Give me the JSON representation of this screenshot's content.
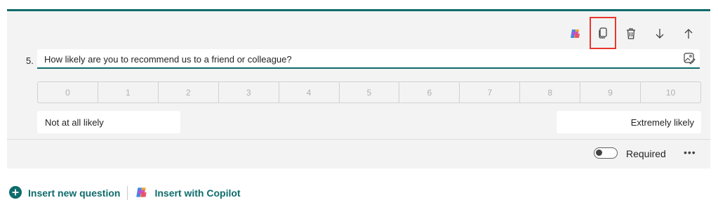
{
  "question": {
    "number": "5.",
    "text": "How likely are you to recommend us to a friend or colleague?"
  },
  "scale": {
    "values": [
      "0",
      "1",
      "2",
      "3",
      "4",
      "5",
      "6",
      "7",
      "8",
      "9",
      "10"
    ],
    "low_label": "Not at all likely",
    "high_label": "Extremely likely"
  },
  "footer": {
    "required_label": "Required",
    "required_on": false,
    "more_label": "•••"
  },
  "actions": {
    "insert_new": "Insert new question",
    "insert_copilot": "Insert with Copilot"
  },
  "toolbar": {
    "icons": [
      "copilot-icon",
      "copy-icon",
      "delete-icon",
      "move-down-icon",
      "move-up-icon"
    ]
  },
  "colors": {
    "accent": "#0f6b6b",
    "highlight": "#e8372d",
    "card_bg": "#f3f3f3"
  }
}
